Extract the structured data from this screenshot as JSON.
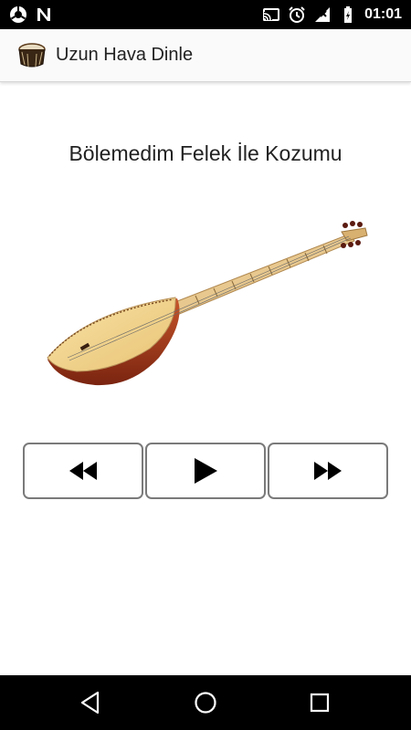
{
  "status_bar": {
    "time": "01:01",
    "icons": [
      "chrome-icon",
      "n-notification-icon",
      "cast-icon",
      "alarm-icon",
      "signal-icon",
      "battery-icon"
    ]
  },
  "app_bar": {
    "icon": "drum-app-icon",
    "title": "Uzun Hava Dinle"
  },
  "player": {
    "song_title": "Bölemedim Felek İle Kozumu",
    "image": "saz-instrument-image",
    "controls": [
      {
        "name": "rewind-button",
        "icon": "rewind-icon"
      },
      {
        "name": "play-button",
        "icon": "play-icon"
      },
      {
        "name": "fast-forward-button",
        "icon": "fast-forward-icon"
      }
    ]
  },
  "nav_bar": {
    "buttons": [
      "back-icon",
      "home-icon",
      "recents-icon"
    ]
  },
  "colors": {
    "status_bar_bg": "#000000",
    "app_bar_bg": "#fafafa",
    "button_border": "#7a7a7a",
    "saz_soundboard": "#f2d58e",
    "saz_bowl": "#b5451b"
  }
}
